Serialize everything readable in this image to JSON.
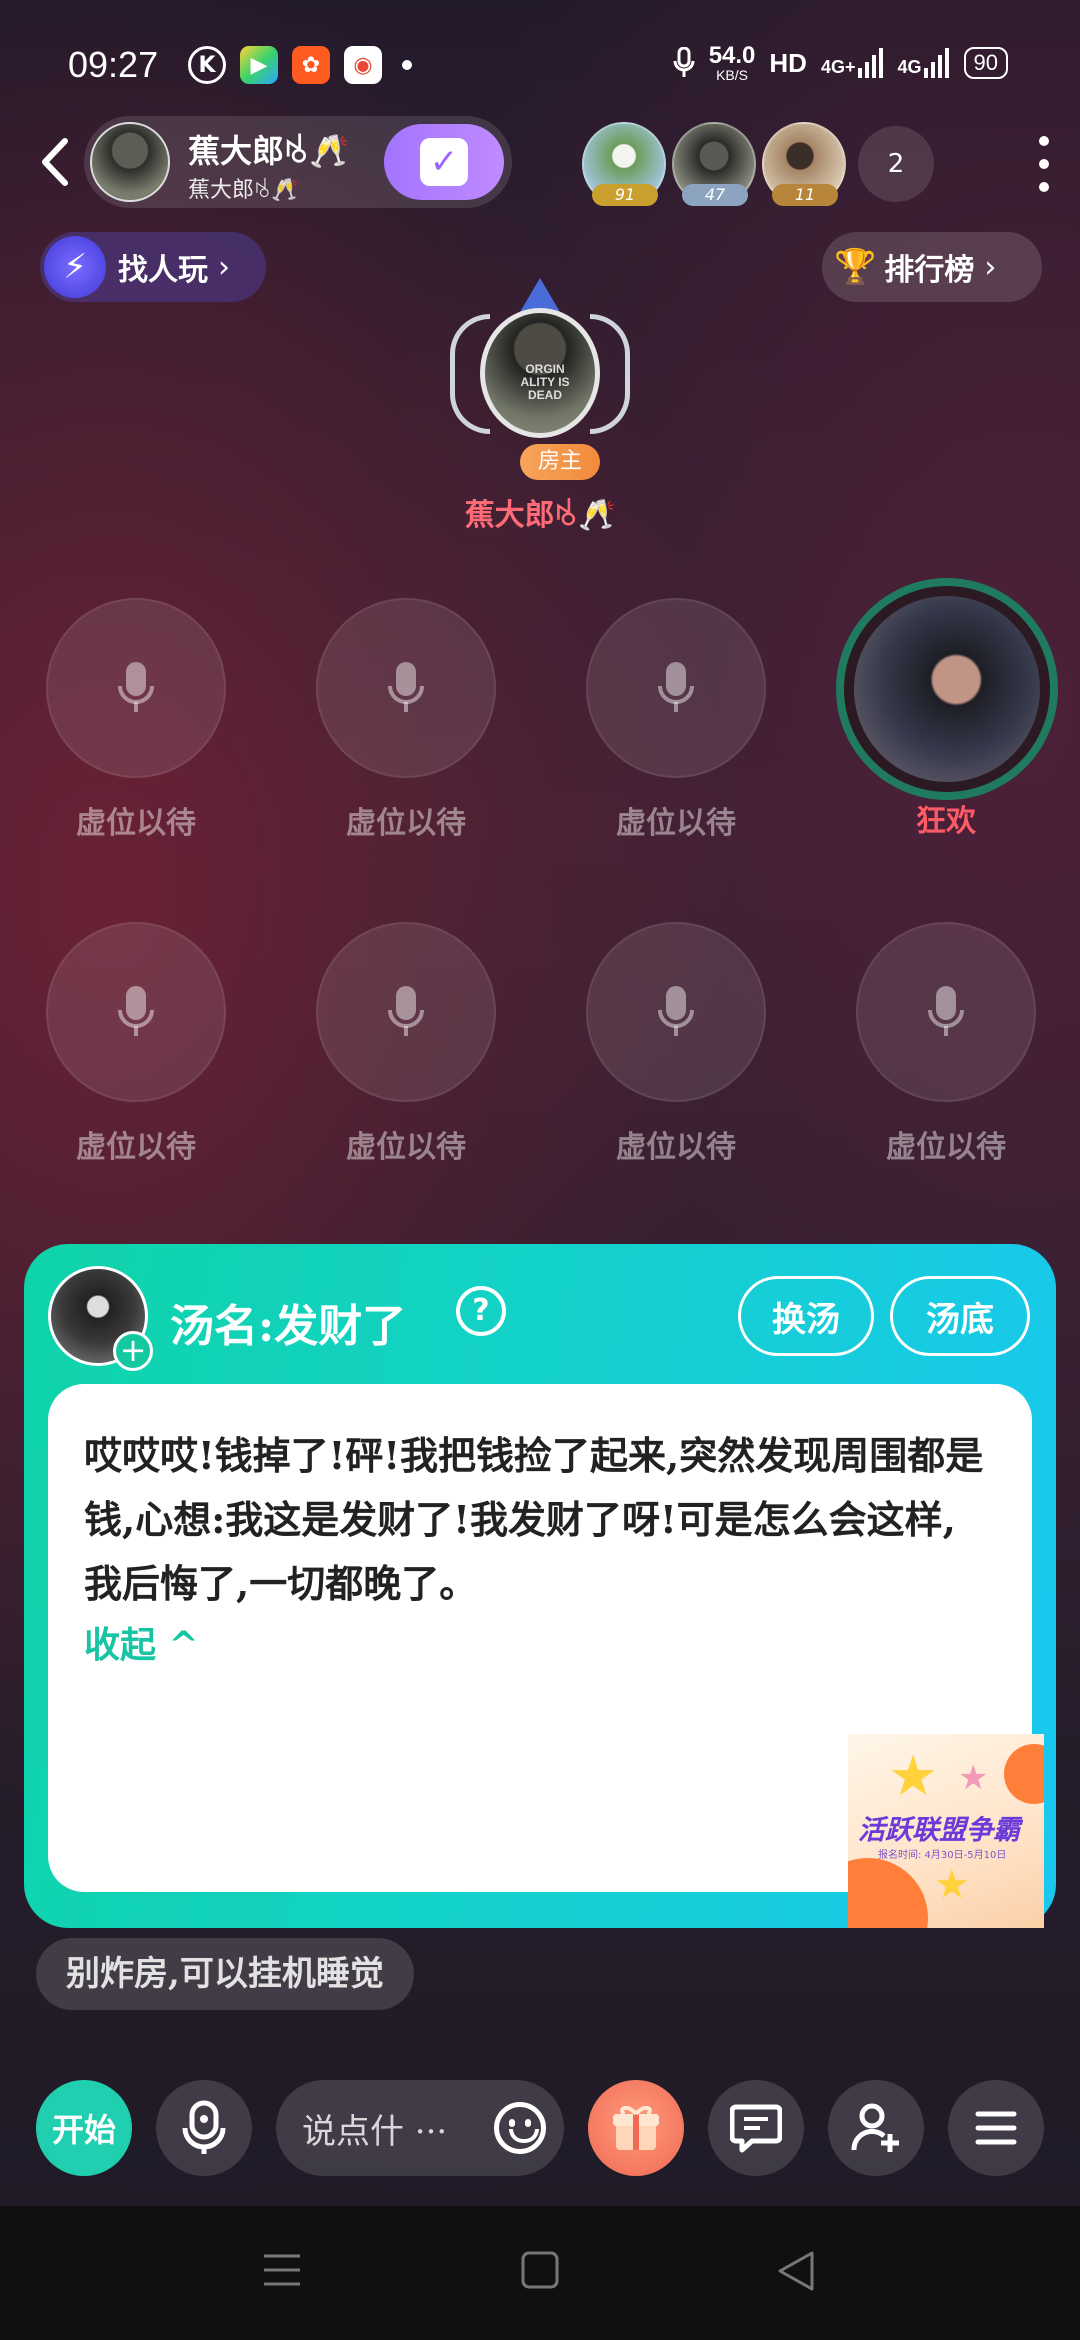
{
  "status_bar": {
    "time": "09:27",
    "app_icons": [
      {
        "name": "k-app-icon",
        "glyph": "K",
        "color": "#ffffff"
      },
      {
        "name": "video-app-icon",
        "glyph": "▶",
        "color": "#3cd26a"
      },
      {
        "name": "kuaishou-icon",
        "glyph": "✿",
        "color": "#ff5a1f"
      },
      {
        "name": "map-app-icon",
        "glyph": "◉",
        "color": "#ffffff"
      }
    ],
    "network_speed_value": "54.0",
    "network_speed_unit": "KB/S",
    "hd_label": "HD",
    "signal_1": "4G+",
    "signal_2": "4G",
    "battery": "90"
  },
  "top_bar": {
    "room_name": "蕉大郎ꂚ🥂",
    "room_sub": "蕉大郎ꂚ🥂",
    "audience": [
      {
        "level": "91",
        "badge_color": "#d8b23a",
        "avatar_color": "#6d9c5a"
      },
      {
        "level": "47",
        "badge_color": "#8ca4c0",
        "avatar_color": "#3a3a3a"
      },
      {
        "level": "11",
        "badge_color": "#b8863a",
        "avatar_color": "#a58565"
      }
    ],
    "audience_count": "2"
  },
  "find_players": {
    "label": "找人玩"
  },
  "leaderboard": {
    "label": "排行榜"
  },
  "host": {
    "tag": "房主",
    "name": "蕉大郎ꂚ🥂",
    "shirt_text": "ORGIN ALITY IS DEAD"
  },
  "seats": {
    "empty_label": "虚位以待",
    "occupied_name": "狂欢"
  },
  "soup_card": {
    "title": "汤名:发财了",
    "help_glyph": "?",
    "change_button": "换汤",
    "answer_button": "汤底",
    "story": "哎哎哎!钱掉了!砰!我把钱捡了起来,突然发现周围都是钱,心想:我这是发财了!我发财了呀!可是怎么会这样,我后悔了,一切都晚了。",
    "collapse_label": "收起 ^",
    "event_title": "活跃联盟争霸",
    "event_date": "报名时间: 4月30日-5月10日"
  },
  "notice": "别炸房,可以挂机睡觉",
  "controls": {
    "start_label": "开始",
    "chat_placeholder": "说点什 ···"
  },
  "colors": {
    "accent_teal": "#1fcfb0",
    "host_name": "#ff6b76",
    "follow_purple": "#b07cff"
  }
}
